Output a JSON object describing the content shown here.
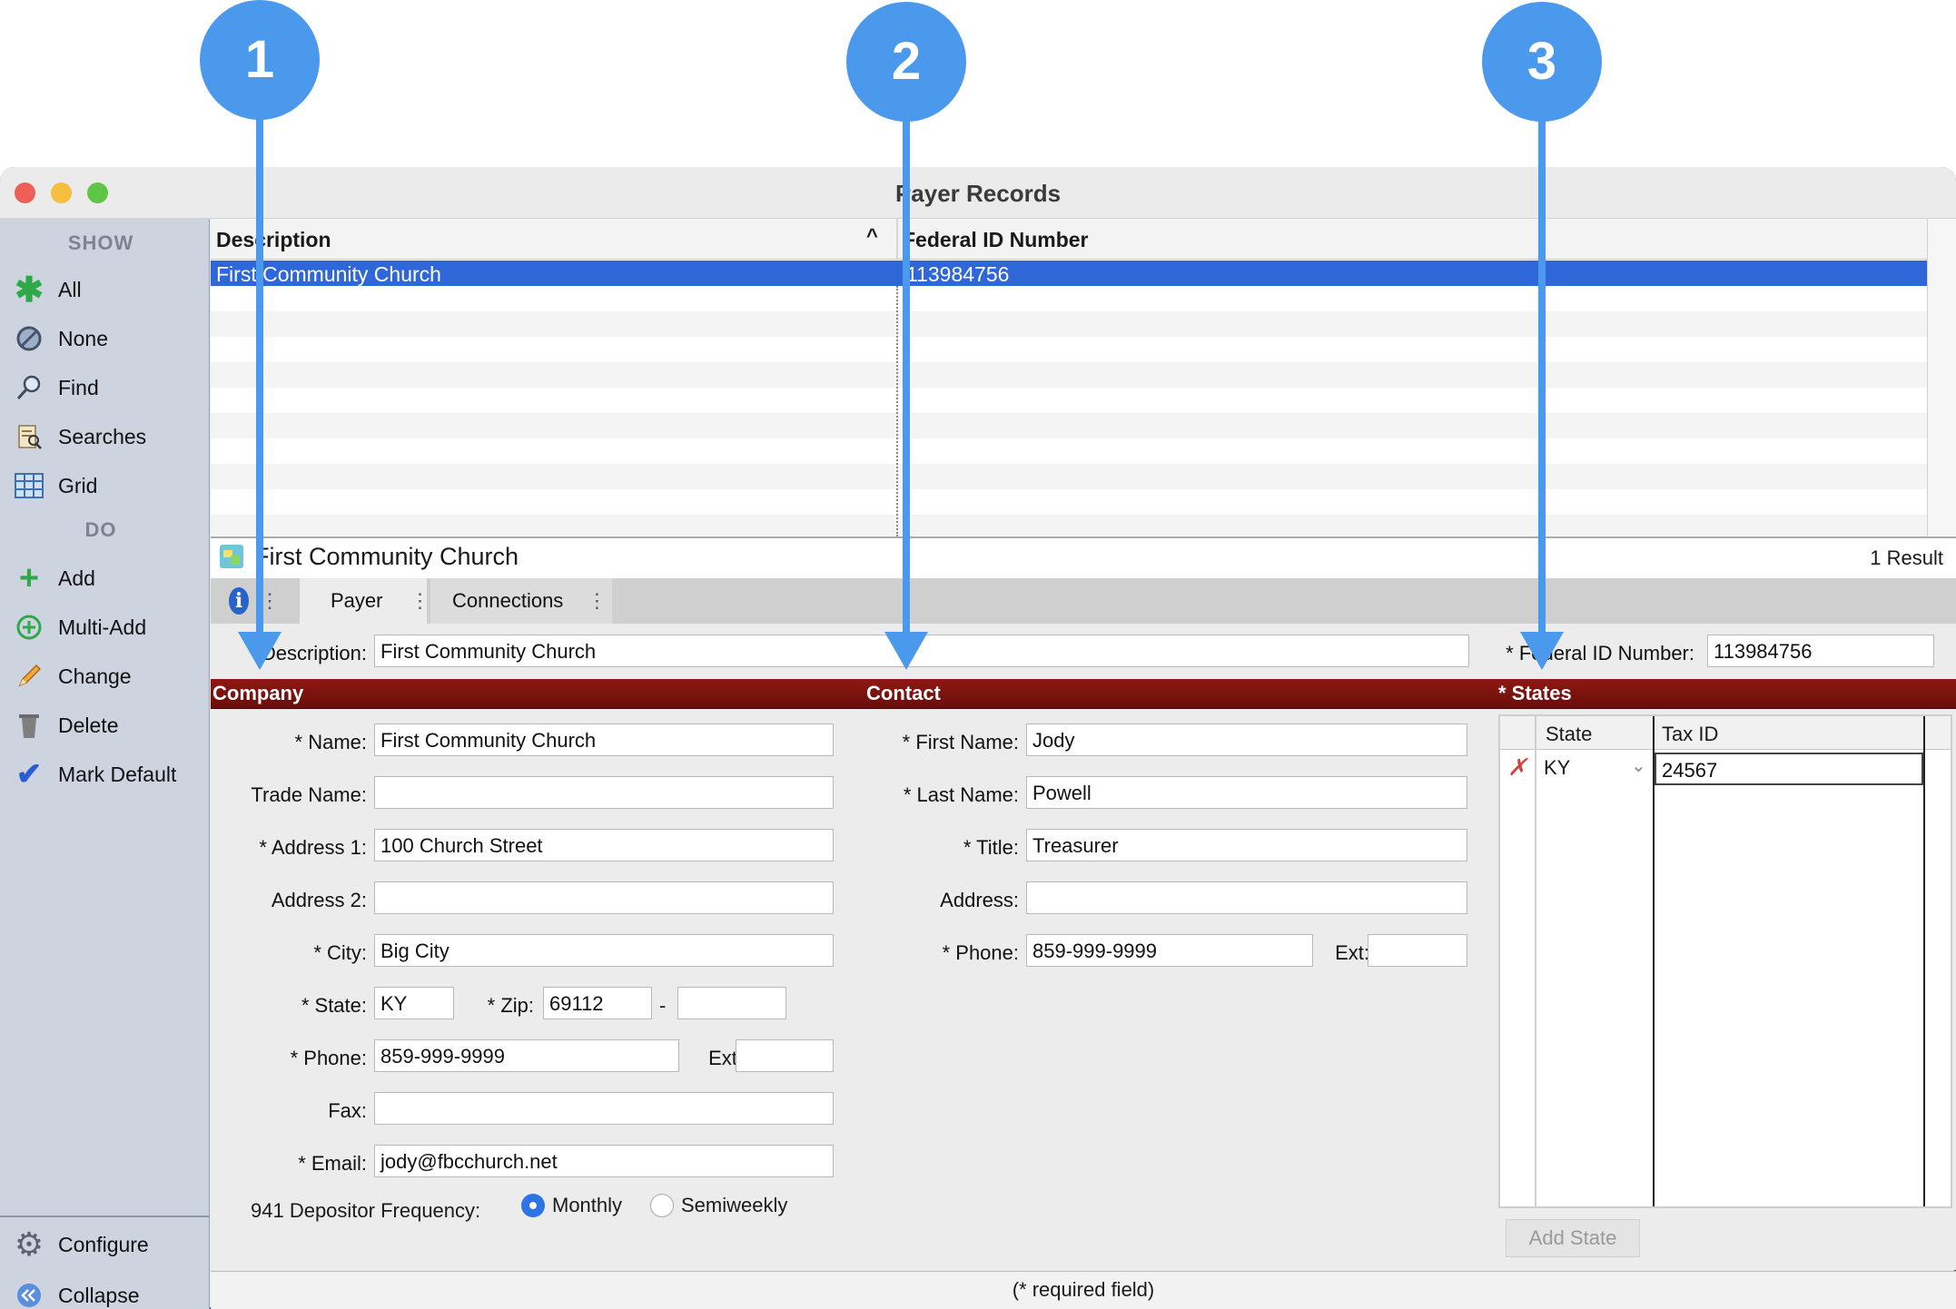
{
  "window": {
    "title": "Payer Records"
  },
  "sidebar": {
    "show_heading": "SHOW",
    "show_items": [
      {
        "label": "All",
        "icon": "asterisk-icon"
      },
      {
        "label": "None",
        "icon": "none-icon"
      },
      {
        "label": "Find",
        "icon": "magnifier-icon"
      },
      {
        "label": "Searches",
        "icon": "searches-icon"
      },
      {
        "label": "Grid",
        "icon": "grid-icon"
      }
    ],
    "do_heading": "DO",
    "do_items": [
      {
        "label": "Add",
        "icon": "plus-icon"
      },
      {
        "label": "Multi-Add",
        "icon": "multi-add-icon"
      },
      {
        "label": "Change",
        "icon": "pencil-icon"
      },
      {
        "label": "Delete",
        "icon": "trash-icon"
      },
      {
        "label": "Mark Default",
        "icon": "checkmark-icon"
      }
    ],
    "bottom_items": [
      {
        "label": "Configure",
        "icon": "gear-icon"
      },
      {
        "label": "Collapse",
        "icon": "collapse-icon"
      }
    ]
  },
  "list": {
    "columns": [
      "Description",
      "Federal ID Number"
    ],
    "sort_indicator": "^",
    "rows": [
      {
        "description": "First Community Church",
        "federal_id": "113984756"
      }
    ]
  },
  "summary": {
    "name": "First Community Church",
    "result_count": "1 Result"
  },
  "tabs": {
    "info": "i",
    "payer": "Payer",
    "connections": "Connections",
    "more": "⋮"
  },
  "form": {
    "description_label": "* Description:",
    "description_value": "First Community Church",
    "federal_id_label": "* Federal ID Number:",
    "federal_id_value": "113984756",
    "company_heading": "Company",
    "contact_heading": "Contact",
    "states_heading": "* States",
    "company": {
      "name_label": "* Name:",
      "name": "First Community Church",
      "trade_name_label": "Trade Name:",
      "trade_name": "",
      "address1_label": "* Address 1:",
      "address1": "100 Church Street",
      "address2_label": "Address 2:",
      "address2": "",
      "city_label": "* City:",
      "city": "Big City",
      "state_label": "* State:",
      "state": "KY",
      "zip_label": "* Zip:",
      "zip": "69112",
      "zip_dash": "-",
      "zip_ext": "",
      "phone_label": "* Phone:",
      "phone": "859-999-9999",
      "ext_label": "Ext:",
      "ext": "",
      "fax_label": "Fax:",
      "fax": "",
      "email_label": "* Email:",
      "email": "jody@fbcchurch.net",
      "depositor_label": "941 Depositor Frequency:",
      "depositor_options": [
        "Monthly",
        "Semiweekly"
      ],
      "depositor_selected": "Monthly"
    },
    "contact": {
      "first_name_label": "* First Name:",
      "first_name": "Jody",
      "last_name_label": "* Last Name:",
      "last_name": "Powell",
      "title_label": "* Title:",
      "title": "Treasurer",
      "address_label": "Address:",
      "address": "",
      "phone_label": "* Phone:",
      "phone": "859-999-9999",
      "ext_label": "Ext:",
      "ext": ""
    },
    "states": {
      "columns": [
        "State",
        "Tax ID"
      ],
      "rows": [
        {
          "state": "KY",
          "tax_id": "24567"
        }
      ],
      "add_button": "Add State"
    },
    "footer_note": "(* required field)"
  },
  "callouts": [
    "1",
    "2",
    "3"
  ],
  "colors": {
    "accent": "#4a99ec",
    "selection": "#2f66d8",
    "section_bar": "#7a110d"
  }
}
